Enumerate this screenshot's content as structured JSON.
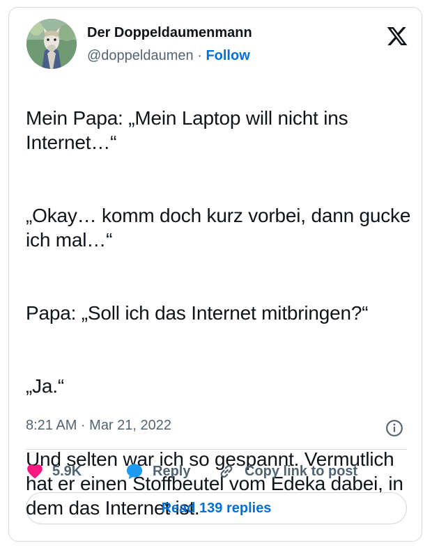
{
  "tweet": {
    "author": {
      "display_name": "Der Doppeldaumenmann",
      "handle": "@doppeldaumen",
      "separator": "·",
      "follow_label": "Follow"
    },
    "paragraphs": [
      "Mein Papa: „Mein Laptop will nicht ins Internet…“",
      "„Okay… komm doch kurz vorbei, dann gucke ich mal…“",
      "Papa: „Soll ich das Internet mitbringen?“",
      "„Ja.“",
      "Und selten war ich so gespannt. Vermutlich hat er einen Stoffbeutel vom Edeka dabei, in dem das Internet ist."
    ],
    "timestamp": "8:21 AM · Mar 21, 2022",
    "actions": {
      "likes_count": "5.9K",
      "reply_label": "Reply",
      "copy_link_label": "Copy link to post"
    },
    "read_replies_label": "Read 139 replies"
  },
  "icons": {
    "platform": "x-logo-icon",
    "like": "heart-icon",
    "reply": "speech-bubble-icon",
    "copy": "link-icon",
    "info": "info-icon"
  },
  "colors": {
    "like": "#f91880",
    "reply": "#1d9bf0",
    "link": "#006fd6",
    "text": "#0f1419",
    "secondary": "#536471",
    "border": "#cfd9de"
  }
}
